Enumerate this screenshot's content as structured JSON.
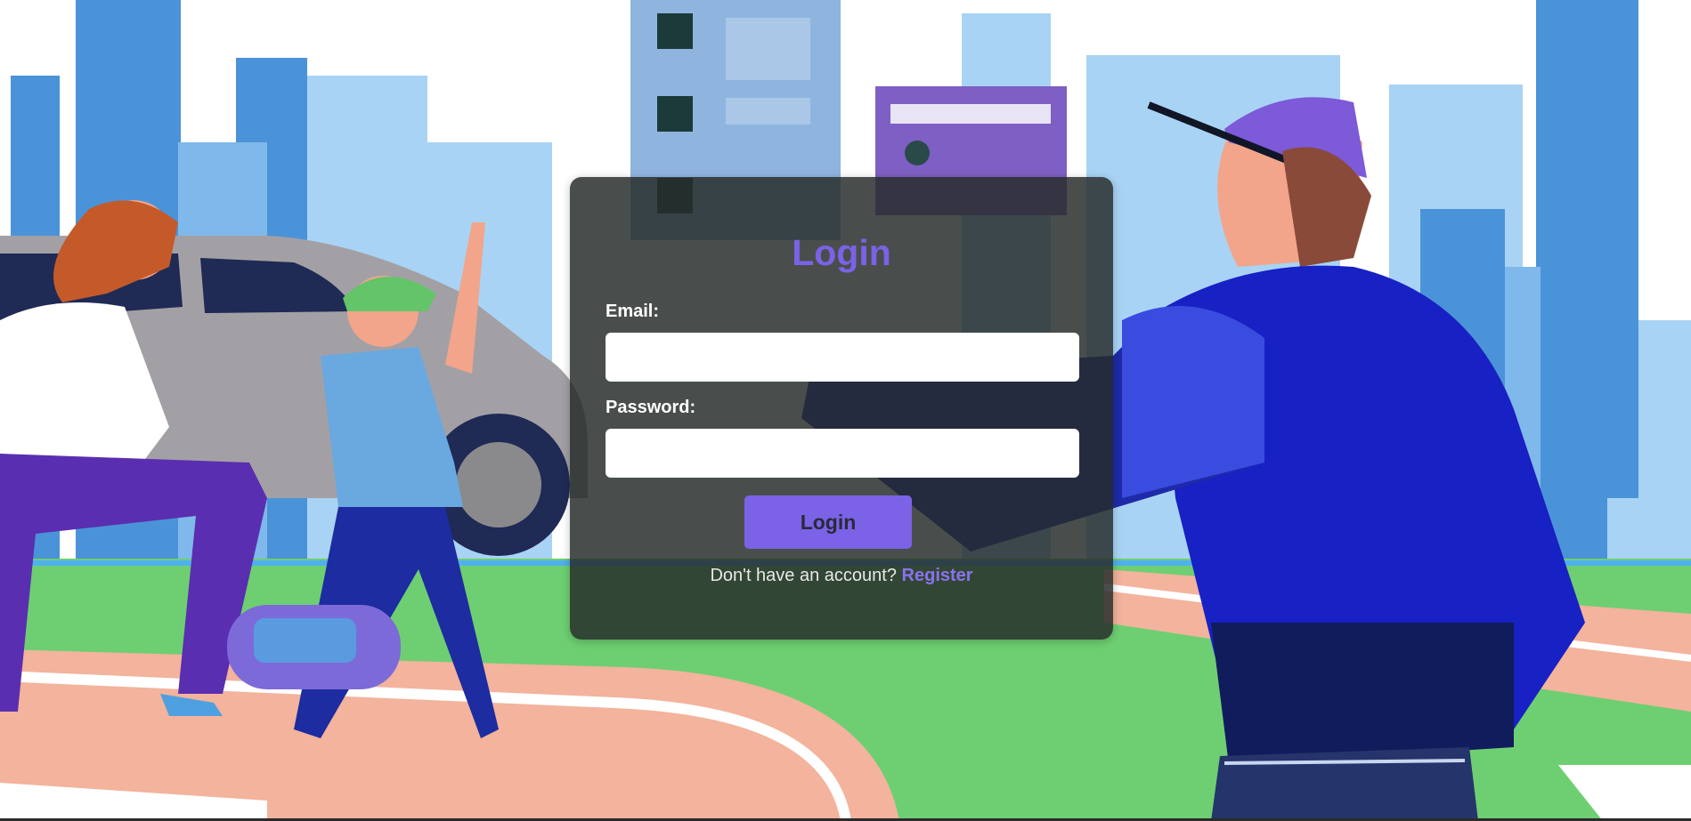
{
  "login_form": {
    "title": "Login",
    "email_label": "Email:",
    "email_value": "",
    "password_label": "Password:",
    "password_value": "",
    "submit_label": "Login",
    "register_prompt": "Don't have an account?",
    "register_link": "Register"
  },
  "colors": {
    "accent": "#7b62e6",
    "card_background": "#262c2a",
    "input_background": "#ffffff"
  }
}
